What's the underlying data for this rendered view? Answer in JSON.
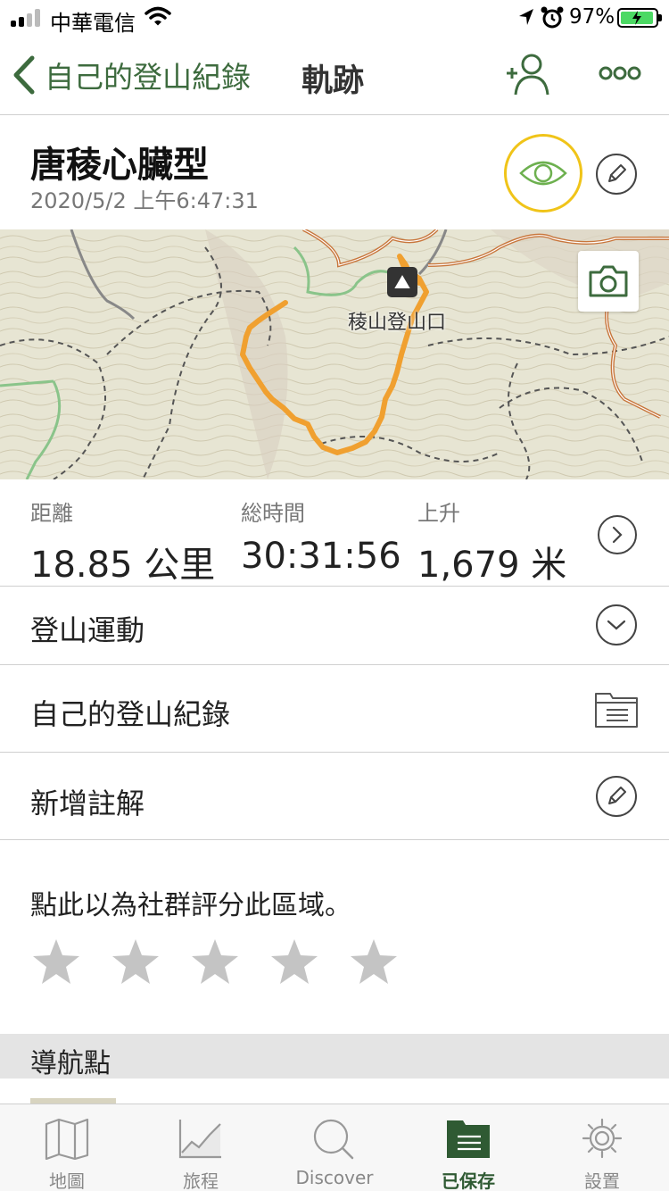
{
  "status_bar": {
    "carrier": "中華電信",
    "battery_percent": "97%"
  },
  "nav": {
    "back_label": "自己的登山紀錄",
    "title": "軌跡"
  },
  "track": {
    "title": "唐稜心臟型",
    "date": "2020/5/2 上午6:47:31"
  },
  "map": {
    "trailhead_label": "稜山登山口",
    "route_color": "#f0a030",
    "trail_color": "#8ac48a",
    "road_color": "#c8763c"
  },
  "stats": [
    {
      "label": "距離",
      "value": "18.85 公里"
    },
    {
      "label": "総時間",
      "value": "30:31:56"
    },
    {
      "label": "上升",
      "value": "1,679 米"
    }
  ],
  "rows": {
    "activity": "登山運動",
    "folder": "自己的登山紀錄",
    "note": "新增註解"
  },
  "rating": {
    "prompt": "點此以為社群評分此區域。",
    "stars_total": 5,
    "stars_filled": 0
  },
  "section": {
    "waypoints_title": "導航點"
  },
  "tabs": [
    {
      "label": "地圖",
      "icon": "map-icon"
    },
    {
      "label": "旅程",
      "icon": "chart-icon"
    },
    {
      "label": "Discover",
      "icon": "search-icon"
    },
    {
      "label": "已保存",
      "icon": "folder-icon",
      "active": true
    },
    {
      "label": "設置",
      "icon": "gear-icon"
    }
  ],
  "colors": {
    "accent": "#3d6b3e",
    "highlight_ring": "#f0c419",
    "visibility_icon": "#6db04f"
  }
}
